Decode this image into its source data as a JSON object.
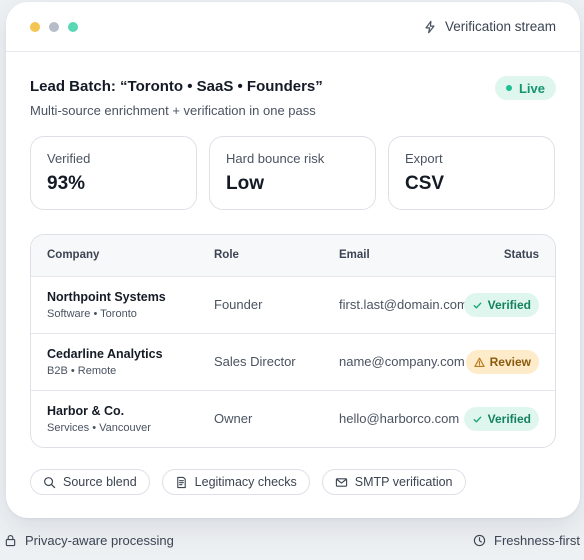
{
  "window": {
    "dot_colors": [
      "#f4c552",
      "#b6bcc8",
      "#5ad7b4"
    ],
    "stream_label": "Verification stream",
    "stream_icon": "lightning-icon"
  },
  "header": {
    "title": "Lead Batch: “Toronto • SaaS • Founders”",
    "subtitle": "Multi-source enrichment + verification in one pass",
    "live_badge": "Live"
  },
  "stats": [
    {
      "label": "Verified",
      "value": "93%"
    },
    {
      "label": "Hard bounce risk",
      "value": "Low"
    },
    {
      "label": "Export",
      "value": "CSV"
    }
  ],
  "table": {
    "columns": {
      "company": "Company",
      "role": "Role",
      "email": "Email",
      "status": "Status"
    },
    "rows": [
      {
        "company": "Northpoint Systems",
        "meta": "Software • Toronto",
        "role": "Founder",
        "email": "first.last@domain.com",
        "status": "Verified",
        "status_kind": "verified"
      },
      {
        "company": "Cedarline Analytics",
        "meta": "B2B • Remote",
        "role": "Sales Director",
        "email": "name@company.com",
        "status": "Review",
        "status_kind": "review"
      },
      {
        "company": "Harbor & Co.",
        "meta": "Services • Vancouver",
        "role": "Owner",
        "email": "hello@harborco.com",
        "status": "Verified",
        "status_kind": "verified"
      }
    ]
  },
  "chips": [
    {
      "label": "Source blend",
      "icon": "search-icon"
    },
    {
      "label": "Legitimacy checks",
      "icon": "document-check-icon"
    },
    {
      "label": "SMTP verification",
      "icon": "mail-icon"
    }
  ],
  "footer": {
    "left": "Privacy-aware processing",
    "left_icon": "lock-icon",
    "right": "Freshness-first",
    "right_icon": "clock-icon"
  },
  "colors": {
    "accent_green": "#1fbf8f",
    "review_amber": "#fdebc9"
  }
}
